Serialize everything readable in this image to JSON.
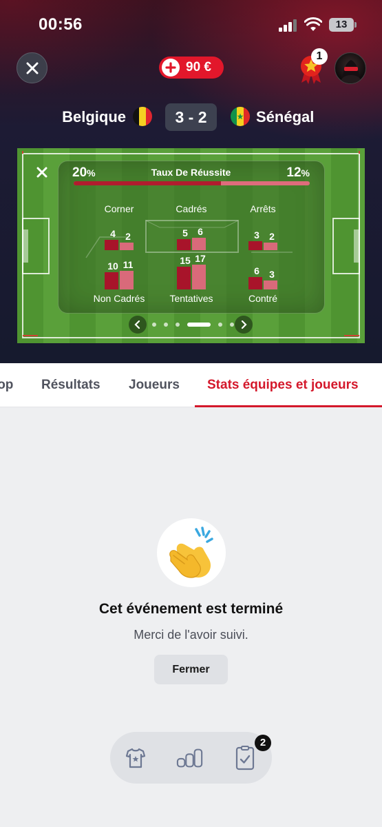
{
  "status_bar": {
    "time": "00:56",
    "battery": "13"
  },
  "header": {
    "balance": "90 €",
    "notification_count": "1"
  },
  "match": {
    "home_team": "Belgique",
    "away_team": "Sénégal",
    "score": "3 - 2"
  },
  "stats": {
    "success_rate": {
      "title": "Taux De Réussite",
      "home_value": "20",
      "away_value": "12",
      "unit": "%",
      "home_share": 0.625
    },
    "items": [
      {
        "label": "Corner",
        "home": 4,
        "away": 2
      },
      {
        "label": "Cadrés",
        "home": 5,
        "away": 6
      },
      {
        "label": "Arrêts",
        "home": 3,
        "away": 2
      },
      {
        "label": "Non Cadrés",
        "home": 10,
        "away": 11
      },
      {
        "label": "Tentatives",
        "home": 15,
        "away": 17
      },
      {
        "label": "Contré",
        "home": 6,
        "away": 3
      }
    ],
    "carousel": {
      "pages": 6,
      "active": 3
    }
  },
  "tabs": [
    {
      "label": "Top",
      "active": false
    },
    {
      "label": "Résultats",
      "active": false
    },
    {
      "label": "Joueurs",
      "active": false
    },
    {
      "label": "Stats équipes et joueurs",
      "active": true
    }
  ],
  "ended": {
    "title": "Cet événement est terminé",
    "subtitle": "Merci de l'avoir suivi.",
    "button": "Fermer"
  },
  "bottom_nav": {
    "icons": [
      "jersey-icon",
      "leaderboard-icon",
      "bet-slip-icon"
    ],
    "badge": "2"
  },
  "colors": {
    "accent_red": "#d4182b",
    "home_bar": "#a8142a",
    "away_bar": "#d96a7a",
    "pitch_green": "#5aa03a"
  }
}
